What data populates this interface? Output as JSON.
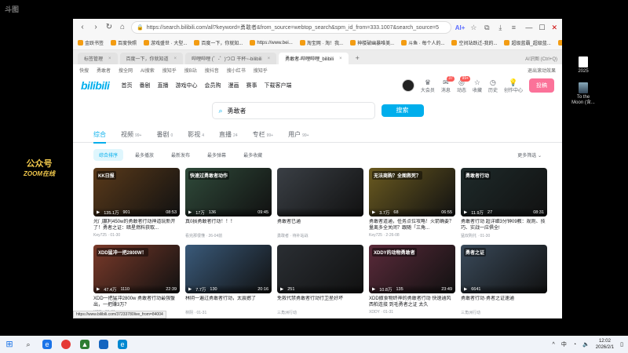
{
  "desktop": {
    "corner_logo": "斗图",
    "watermark": {
      "line1": "公众号",
      "line2": "ZOOM在线"
    },
    "icons": [
      {
        "label": "2025"
      },
      {
        "label": "To the Moon (含..."
      }
    ]
  },
  "browser": {
    "url": "https://search.bilibili.com/all?keyword=勇敢者&from_source=webtop_search&spm_id_from=333.1007&search_source=5",
    "ai_label": "AI+",
    "bookmarks": [
      "金跃书签",
      "百度快照",
      "游戏盛世 · 大型...",
      "百度一下，你就知...",
      "https://www.bei...",
      "淘宝网 · 淘！我...",
      "神楼破幽暴唯美...",
      "斗鱼 · 每个人的...",
      "空间站跃迁-我的...",
      "超级蓝霸_超级蓝...",
      "亚博天下",
      "电影院 (1)",
      "更多"
    ],
    "tabs": [
      {
        "label": "标签管理",
        "active": false
      },
      {
        "label": "百度一下，你就知道",
        "active": false
      },
      {
        "label": "哔哩哔哩 (゜-゜)つロ 干杯~-bilibili",
        "active": false
      },
      {
        "label": "勇敢者-哔哩哔哩_bilibili",
        "active": true
      }
    ],
    "tab_right": "AI识图 (Ctrl+Q)"
  },
  "page": {
    "topnav": [
      "快搜",
      "勇敢者",
      "搜全网",
      "AI搜索",
      "搜知乎",
      "搜B站",
      "搜抖音",
      "搜小红书",
      "搜知乎"
    ],
    "topnav_right": "退出滚动效果",
    "header_links": [
      "首页",
      "番剧",
      "直播",
      "游戏中心",
      "会员购",
      "漫画",
      "赛事",
      "下载客户端"
    ],
    "header_icons": [
      {
        "label": "大会员",
        "badge": ""
      },
      {
        "label": "消息",
        "badge": "37"
      },
      {
        "label": "动态",
        "badge": "99+"
      },
      {
        "label": "收藏",
        "badge": ""
      },
      {
        "label": "历史",
        "badge": ""
      },
      {
        "label": "创作中心",
        "badge": ""
      }
    ],
    "upload_label": "投稿",
    "search": {
      "value": "勇敢者",
      "button": "搜索"
    },
    "type_tabs": [
      {
        "label": "综合",
        "count": "",
        "active": true
      },
      {
        "label": "视频",
        "count": "99+",
        "active": false
      },
      {
        "label": "番剧",
        "count": "0",
        "active": false
      },
      {
        "label": "影视",
        "count": "4",
        "active": false
      },
      {
        "label": "直播",
        "count": "24",
        "active": false
      },
      {
        "label": "专栏",
        "count": "99+",
        "active": false
      },
      {
        "label": "用户",
        "count": "99+",
        "active": false
      }
    ],
    "sort_options": [
      {
        "label": "综合排序",
        "active": true
      },
      {
        "label": "最多播放",
        "active": false
      },
      {
        "label": "最新发布",
        "active": false
      },
      {
        "label": "最多弹幕",
        "active": false
      },
      {
        "label": "最多收藏",
        "active": false
      }
    ],
    "more_filter": "更多筛选 ⌄",
    "videos": [
      {
        "tag": "KK日报",
        "plays": "135.1万",
        "danmaku": "901",
        "duration": "08:53",
        "title": "光门赢利450w的勇敢者行动神道玩新开了！勇者之证：暗星燃料获取...",
        "meta": "Key725 · 01-30",
        "bg": "#5a3a1a"
      },
      {
        "tag": "快速过勇敢者动作",
        "plays": "17万",
        "danmaku": "136",
        "duration": "09:45",
        "title": "真0损勇敢者行动！！！",
        "meta": "看完那很懂 · 26-04前",
        "bg": "#2f4a3a"
      },
      {
        "tag": "",
        "plays": "",
        "danmaku": "",
        "duration": "",
        "title": "勇敢者已通",
        "meta": "勇敢者 · 待补站战",
        "bg": "#3a3f45"
      },
      {
        "tag": "无法商购？全图救死？",
        "plays": "3.7万",
        "danmaku": "68",
        "duration": "06:55",
        "title": "勇敢者道通，任务点位攻略！火箭确要？量离多全关闭？跟随「三角...",
        "meta": "Key725 · 2-26-08",
        "bg": "#6a5a20"
      },
      {
        "tag": "勇敢者行动",
        "plays": "11.9万",
        "danmaku": "27",
        "duration": "08:31",
        "title": "勇敢者行动 超详细3分钟09教：规则、技巧、实战一应俱全!",
        "meta": "猛双购托 · 01-30",
        "bg": "#1e2a2a"
      },
      {
        "tag": "XDD猛冲一把2800W！",
        "plays": "47.4万",
        "danmaku": "1110",
        "duration": "22:39",
        "title": "XDD一把猛冲2800w 勇敢者行动最强蟹出，一把赚3万？",
        "meta": "XDD · 01-31",
        "bg": "#7a3a2a"
      },
      {
        "tag": "",
        "plays": "7.7万",
        "danmaku": "130",
        "duration": "20:16",
        "title": "林阴一遍过勇敢者行动，太震撼了",
        "meta": "林阴 · 01-31",
        "bg": "#3a5a7a"
      },
      {
        "tag": "",
        "plays": "251",
        "danmaku": "",
        "duration": "",
        "title": "免救代禁勇敢者行动行卫星好坏",
        "meta": "三角洲行动",
        "bg": "#2a2e33"
      },
      {
        "tag": "XDDY的动物勇敢者",
        "plays": "10.8万",
        "danmaku": "135",
        "duration": "23:49",
        "title": "XDD撤食物终神的勇敢者行动 快速通风西柏连接 到毛勇者之证 太久",
        "meta": "XDDY · 01-31",
        "bg": "#5a2a3a"
      },
      {
        "tag": "勇者之证",
        "plays": "6641",
        "danmaku": "",
        "duration": "",
        "title": "勇敢者行动·勇者之证速通",
        "meta": "三角洲行动",
        "bg": "#3a4a5a"
      }
    ],
    "status_link": "https://www.bilibili.com/37233780live_from=84004"
  },
  "taskbar": {
    "apps": [
      "windows-logo",
      "search-icon",
      "browser-icon",
      "red-app-icon",
      "green-app-icon",
      "blue-app-icon",
      "edge-icon"
    ],
    "ime": "中",
    "time": "12:02",
    "date": "2026/2/1"
  }
}
